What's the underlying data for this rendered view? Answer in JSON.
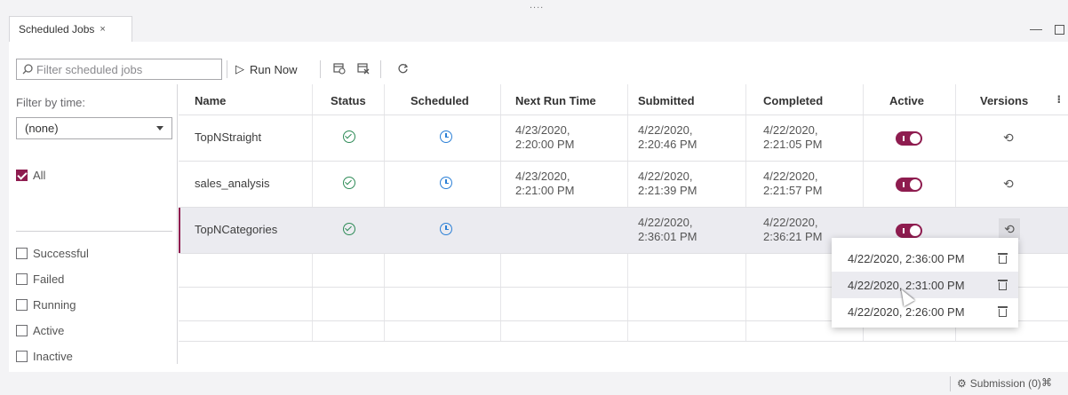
{
  "handle": "....",
  "tab": {
    "title": "Scheduled Jobs",
    "close": "×"
  },
  "window": {
    "minimize": "—"
  },
  "toolbar": {
    "search_placeholder": "Filter scheduled jobs",
    "run_now_label": "Run Now",
    "run_now_icon": "▷"
  },
  "filter": {
    "label": "Filter by time:",
    "select_value": "(none)",
    "all_label": "All",
    "options": [
      "Successful",
      "Failed",
      "Running",
      "Active",
      "Inactive"
    ]
  },
  "columns": [
    "Name",
    "Status",
    "Scheduled",
    "Next Run Time",
    "Submitted",
    "Completed",
    "Active",
    "Versions"
  ],
  "rows": [
    {
      "name": "TopNStraight",
      "next_run_1": "4/23/2020,",
      "next_run_2": "2:20:00 PM",
      "submitted_1": "4/22/2020,",
      "submitted_2": "2:20:46 PM",
      "completed_1": "4/22/2020,",
      "completed_2": "2:21:05 PM",
      "active": true,
      "selected": false
    },
    {
      "name": "sales_analysis",
      "next_run_1": "4/23/2020,",
      "next_run_2": "2:21:00 PM",
      "submitted_1": "4/22/2020,",
      "submitted_2": "2:21:39 PM",
      "completed_1": "4/22/2020,",
      "completed_2": "2:21:57 PM",
      "active": true,
      "selected": false
    },
    {
      "name": "TopNCategories",
      "next_run_1": "",
      "next_run_2": "",
      "submitted_1": "4/22/2020,",
      "submitted_2": "2:36:01 PM",
      "completed_1": "4/22/2020,",
      "completed_2": "2:36:21 PM",
      "active": true,
      "selected": true
    }
  ],
  "versions_popup": [
    "4/22/2020, 2:36:00 PM",
    "4/22/2020, 2:31:00 PM",
    "4/22/2020, 2:26:00 PM"
  ],
  "statusbar": {
    "submission_label": "Submission (0)"
  },
  "colors": {
    "accent": "#8e1c4f",
    "success": "#2e8b57",
    "schedule": "#2a7fd6"
  },
  "icons": {
    "status": "check-circle-icon",
    "scheduled": "clock-icon",
    "versions": "history-icon",
    "delete": "trash-icon"
  }
}
